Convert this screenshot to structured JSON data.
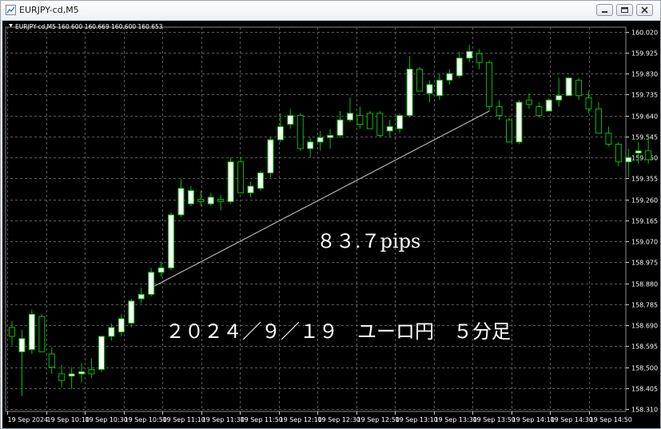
{
  "window": {
    "title": "EURJPY-cd,M5",
    "buttons": [
      "minimize-icon",
      "maximize-icon",
      "close-icon"
    ]
  },
  "chart_data": {
    "type": "candlestick",
    "info_text": "EURJPY-cd,M5  160.600 160.669 160.600 160.653",
    "annotations": [
      "８３.７pips",
      "２０２４／９／１９　ユーロ円　５分足"
    ],
    "colors": {
      "background": "#000000",
      "grid": "#5a5a5a",
      "bull_body": "#ffffff",
      "bear_body": "#000000",
      "wick": "#00c000",
      "trendline": "#d0d0d0",
      "text": "#ffffff"
    },
    "grid": true,
    "ylim": [
      158.3,
      160.04
    ],
    "y_ticks": [
      "160.020",
      "159.925",
      "159.830",
      "159.735",
      "159.640",
      "159.545",
      "159.450",
      "159.355",
      "159.260",
      "159.165",
      "159.070",
      "158.975",
      "158.880",
      "158.785",
      "158.690",
      "158.595",
      "158.500",
      "158.405",
      "158.310"
    ],
    "x_ticks": [
      "19 Sep 2024",
      "19 Sep 10:10",
      "19 Sep 10:30",
      "19 Sep 10:50",
      "19 Sep 11:10",
      "19 Sep 11:30",
      "19 Sep 11:50",
      "19 Sep 12:10",
      "19 Sep 12:30",
      "19 Sep 12:50",
      "19 Sep 13:10",
      "19 Sep 13:30",
      "19 Sep 13:50",
      "19 Sep 14:10",
      "19 Sep 14:30",
      "19 Sep 14:50"
    ],
    "candles": [
      {
        "o": 158.68,
        "h": 158.71,
        "l": 158.6,
        "c": 158.64
      },
      {
        "o": 158.57,
        "h": 158.67,
        "l": 158.37,
        "c": 158.63
      },
      {
        "o": 158.58,
        "h": 158.76,
        "l": 158.56,
        "c": 158.74
      },
      {
        "o": 158.73,
        "h": 158.74,
        "l": 158.57,
        "c": 158.57
      },
      {
        "o": 158.56,
        "h": 158.59,
        "l": 158.47,
        "c": 158.5
      },
      {
        "o": 158.47,
        "h": 158.51,
        "l": 158.41,
        "c": 158.44
      },
      {
        "o": 158.46,
        "h": 158.5,
        "l": 158.4,
        "c": 158.47
      },
      {
        "o": 158.47,
        "h": 158.52,
        "l": 158.43,
        "c": 158.48
      },
      {
        "o": 158.49,
        "h": 158.54,
        "l": 158.45,
        "c": 158.47
      },
      {
        "o": 158.49,
        "h": 158.64,
        "l": 158.48,
        "c": 158.64
      },
      {
        "o": 158.64,
        "h": 158.7,
        "l": 158.62,
        "c": 158.68
      },
      {
        "o": 158.66,
        "h": 158.74,
        "l": 158.64,
        "c": 158.72
      },
      {
        "o": 158.7,
        "h": 158.81,
        "l": 158.68,
        "c": 158.8
      },
      {
        "o": 158.81,
        "h": 158.86,
        "l": 158.79,
        "c": 158.83
      },
      {
        "o": 158.83,
        "h": 158.95,
        "l": 158.82,
        "c": 158.93
      },
      {
        "o": 158.93,
        "h": 158.98,
        "l": 158.91,
        "c": 158.95
      },
      {
        "o": 158.95,
        "h": 159.2,
        "l": 158.94,
        "c": 159.19
      },
      {
        "o": 159.19,
        "h": 159.35,
        "l": 159.18,
        "c": 159.31
      },
      {
        "o": 159.24,
        "h": 159.32,
        "l": 159.23,
        "c": 159.3
      },
      {
        "o": 159.26,
        "h": 159.3,
        "l": 159.23,
        "c": 159.25
      },
      {
        "o": 159.24,
        "h": 159.29,
        "l": 159.23,
        "c": 159.27
      },
      {
        "o": 159.26,
        "h": 159.28,
        "l": 159.21,
        "c": 159.25
      },
      {
        "o": 159.25,
        "h": 159.45,
        "l": 159.24,
        "c": 159.43
      },
      {
        "o": 159.43,
        "h": 159.45,
        "l": 159.29,
        "c": 159.29
      },
      {
        "o": 159.29,
        "h": 159.34,
        "l": 159.27,
        "c": 159.32
      },
      {
        "o": 159.31,
        "h": 159.39,
        "l": 159.3,
        "c": 159.38
      },
      {
        "o": 159.38,
        "h": 159.54,
        "l": 159.36,
        "c": 159.53
      },
      {
        "o": 159.53,
        "h": 159.65,
        "l": 159.52,
        "c": 159.59
      },
      {
        "o": 159.6,
        "h": 159.67,
        "l": 159.58,
        "c": 159.64
      },
      {
        "o": 159.64,
        "h": 159.65,
        "l": 159.48,
        "c": 159.49
      },
      {
        "o": 159.49,
        "h": 159.54,
        "l": 159.45,
        "c": 159.52
      },
      {
        "o": 159.52,
        "h": 159.57,
        "l": 159.48,
        "c": 159.54
      },
      {
        "o": 159.54,
        "h": 159.58,
        "l": 159.49,
        "c": 159.55
      },
      {
        "o": 159.55,
        "h": 159.66,
        "l": 159.54,
        "c": 159.62
      },
      {
        "o": 159.62,
        "h": 159.72,
        "l": 159.61,
        "c": 159.65
      },
      {
        "o": 159.64,
        "h": 159.68,
        "l": 159.58,
        "c": 159.6
      },
      {
        "o": 159.65,
        "h": 159.66,
        "l": 159.58,
        "c": 159.58
      },
      {
        "o": 159.65,
        "h": 159.66,
        "l": 159.54,
        "c": 159.55
      },
      {
        "o": 159.57,
        "h": 159.62,
        "l": 159.54,
        "c": 159.59
      },
      {
        "o": 159.58,
        "h": 159.65,
        "l": 159.56,
        "c": 159.64
      },
      {
        "o": 159.64,
        "h": 159.91,
        "l": 159.63,
        "c": 159.85
      },
      {
        "o": 159.85,
        "h": 159.86,
        "l": 159.75,
        "c": 159.75
      },
      {
        "o": 159.74,
        "h": 159.8,
        "l": 159.7,
        "c": 159.78
      },
      {
        "o": 159.73,
        "h": 159.83,
        "l": 159.71,
        "c": 159.8
      },
      {
        "o": 159.8,
        "h": 159.85,
        "l": 159.78,
        "c": 159.83
      },
      {
        "o": 159.82,
        "h": 159.93,
        "l": 159.81,
        "c": 159.9
      },
      {
        "o": 159.9,
        "h": 159.96,
        "l": 159.88,
        "c": 159.93
      },
      {
        "o": 159.92,
        "h": 159.94,
        "l": 159.85,
        "c": 159.88
      },
      {
        "o": 159.88,
        "h": 159.89,
        "l": 159.66,
        "c": 159.68
      },
      {
        "o": 159.68,
        "h": 159.71,
        "l": 159.62,
        "c": 159.64
      },
      {
        "o": 159.62,
        "h": 159.63,
        "l": 159.52,
        "c": 159.52
      },
      {
        "o": 159.52,
        "h": 159.71,
        "l": 159.51,
        "c": 159.7
      },
      {
        "o": 159.71,
        "h": 159.74,
        "l": 159.67,
        "c": 159.69
      },
      {
        "o": 159.68,
        "h": 159.7,
        "l": 159.63,
        "c": 159.64
      },
      {
        "o": 159.66,
        "h": 159.72,
        "l": 159.66,
        "c": 159.71
      },
      {
        "o": 159.71,
        "h": 159.81,
        "l": 159.68,
        "c": 159.73
      },
      {
        "o": 159.73,
        "h": 159.81,
        "l": 159.73,
        "c": 159.81
      },
      {
        "o": 159.8,
        "h": 159.81,
        "l": 159.71,
        "c": 159.73
      },
      {
        "o": 159.72,
        "h": 159.75,
        "l": 159.65,
        "c": 159.67
      },
      {
        "o": 159.67,
        "h": 159.7,
        "l": 159.56,
        "c": 159.56
      },
      {
        "o": 159.56,
        "h": 159.59,
        "l": 159.5,
        "c": 159.51
      },
      {
        "o": 159.51,
        "h": 159.52,
        "l": 159.41,
        "c": 159.43
      },
      {
        "o": 159.43,
        "h": 159.49,
        "l": 159.36,
        "c": 159.45
      },
      {
        "o": 159.47,
        "h": 159.52,
        "l": 159.42,
        "c": 159.48
      },
      {
        "o": 159.48,
        "h": 159.55,
        "l": 159.42,
        "c": 159.44
      }
    ],
    "trendline": {
      "from": {
        "candle": 14,
        "price": 158.86
      },
      "to": {
        "candle": 48,
        "price": 159.66
      }
    }
  }
}
